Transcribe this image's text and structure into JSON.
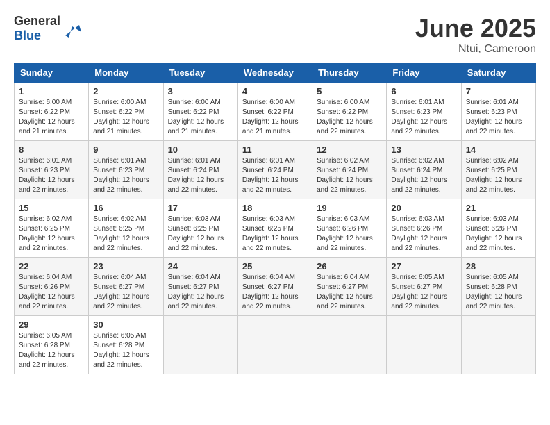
{
  "header": {
    "logo_general": "General",
    "logo_blue": "Blue",
    "month": "June 2025",
    "location": "Ntui, Cameroon"
  },
  "weekdays": [
    "Sunday",
    "Monday",
    "Tuesday",
    "Wednesday",
    "Thursday",
    "Friday",
    "Saturday"
  ],
  "weeks": [
    [
      {
        "day": "1",
        "info": "Sunrise: 6:00 AM\nSunset: 6:22 PM\nDaylight: 12 hours\nand 21 minutes."
      },
      {
        "day": "2",
        "info": "Sunrise: 6:00 AM\nSunset: 6:22 PM\nDaylight: 12 hours\nand 21 minutes."
      },
      {
        "day": "3",
        "info": "Sunrise: 6:00 AM\nSunset: 6:22 PM\nDaylight: 12 hours\nand 21 minutes."
      },
      {
        "day": "4",
        "info": "Sunrise: 6:00 AM\nSunset: 6:22 PM\nDaylight: 12 hours\nand 21 minutes."
      },
      {
        "day": "5",
        "info": "Sunrise: 6:00 AM\nSunset: 6:22 PM\nDaylight: 12 hours\nand 22 minutes."
      },
      {
        "day": "6",
        "info": "Sunrise: 6:01 AM\nSunset: 6:23 PM\nDaylight: 12 hours\nand 22 minutes."
      },
      {
        "day": "7",
        "info": "Sunrise: 6:01 AM\nSunset: 6:23 PM\nDaylight: 12 hours\nand 22 minutes."
      }
    ],
    [
      {
        "day": "8",
        "info": "Sunrise: 6:01 AM\nSunset: 6:23 PM\nDaylight: 12 hours\nand 22 minutes."
      },
      {
        "day": "9",
        "info": "Sunrise: 6:01 AM\nSunset: 6:23 PM\nDaylight: 12 hours\nand 22 minutes."
      },
      {
        "day": "10",
        "info": "Sunrise: 6:01 AM\nSunset: 6:24 PM\nDaylight: 12 hours\nand 22 minutes."
      },
      {
        "day": "11",
        "info": "Sunrise: 6:01 AM\nSunset: 6:24 PM\nDaylight: 12 hours\nand 22 minutes."
      },
      {
        "day": "12",
        "info": "Sunrise: 6:02 AM\nSunset: 6:24 PM\nDaylight: 12 hours\nand 22 minutes."
      },
      {
        "day": "13",
        "info": "Sunrise: 6:02 AM\nSunset: 6:24 PM\nDaylight: 12 hours\nand 22 minutes."
      },
      {
        "day": "14",
        "info": "Sunrise: 6:02 AM\nSunset: 6:25 PM\nDaylight: 12 hours\nand 22 minutes."
      }
    ],
    [
      {
        "day": "15",
        "info": "Sunrise: 6:02 AM\nSunset: 6:25 PM\nDaylight: 12 hours\nand 22 minutes."
      },
      {
        "day": "16",
        "info": "Sunrise: 6:02 AM\nSunset: 6:25 PM\nDaylight: 12 hours\nand 22 minutes."
      },
      {
        "day": "17",
        "info": "Sunrise: 6:03 AM\nSunset: 6:25 PM\nDaylight: 12 hours\nand 22 minutes."
      },
      {
        "day": "18",
        "info": "Sunrise: 6:03 AM\nSunset: 6:25 PM\nDaylight: 12 hours\nand 22 minutes."
      },
      {
        "day": "19",
        "info": "Sunrise: 6:03 AM\nSunset: 6:26 PM\nDaylight: 12 hours\nand 22 minutes."
      },
      {
        "day": "20",
        "info": "Sunrise: 6:03 AM\nSunset: 6:26 PM\nDaylight: 12 hours\nand 22 minutes."
      },
      {
        "day": "21",
        "info": "Sunrise: 6:03 AM\nSunset: 6:26 PM\nDaylight: 12 hours\nand 22 minutes."
      }
    ],
    [
      {
        "day": "22",
        "info": "Sunrise: 6:04 AM\nSunset: 6:26 PM\nDaylight: 12 hours\nand 22 minutes."
      },
      {
        "day": "23",
        "info": "Sunrise: 6:04 AM\nSunset: 6:27 PM\nDaylight: 12 hours\nand 22 minutes."
      },
      {
        "day": "24",
        "info": "Sunrise: 6:04 AM\nSunset: 6:27 PM\nDaylight: 12 hours\nand 22 minutes."
      },
      {
        "day": "25",
        "info": "Sunrise: 6:04 AM\nSunset: 6:27 PM\nDaylight: 12 hours\nand 22 minutes."
      },
      {
        "day": "26",
        "info": "Sunrise: 6:04 AM\nSunset: 6:27 PM\nDaylight: 12 hours\nand 22 minutes."
      },
      {
        "day": "27",
        "info": "Sunrise: 6:05 AM\nSunset: 6:27 PM\nDaylight: 12 hours\nand 22 minutes."
      },
      {
        "day": "28",
        "info": "Sunrise: 6:05 AM\nSunset: 6:28 PM\nDaylight: 12 hours\nand 22 minutes."
      }
    ],
    [
      {
        "day": "29",
        "info": "Sunrise: 6:05 AM\nSunset: 6:28 PM\nDaylight: 12 hours\nand 22 minutes."
      },
      {
        "day": "30",
        "info": "Sunrise: 6:05 AM\nSunset: 6:28 PM\nDaylight: 12 hours\nand 22 minutes."
      },
      {
        "day": "",
        "info": ""
      },
      {
        "day": "",
        "info": ""
      },
      {
        "day": "",
        "info": ""
      },
      {
        "day": "",
        "info": ""
      },
      {
        "day": "",
        "info": ""
      }
    ]
  ]
}
